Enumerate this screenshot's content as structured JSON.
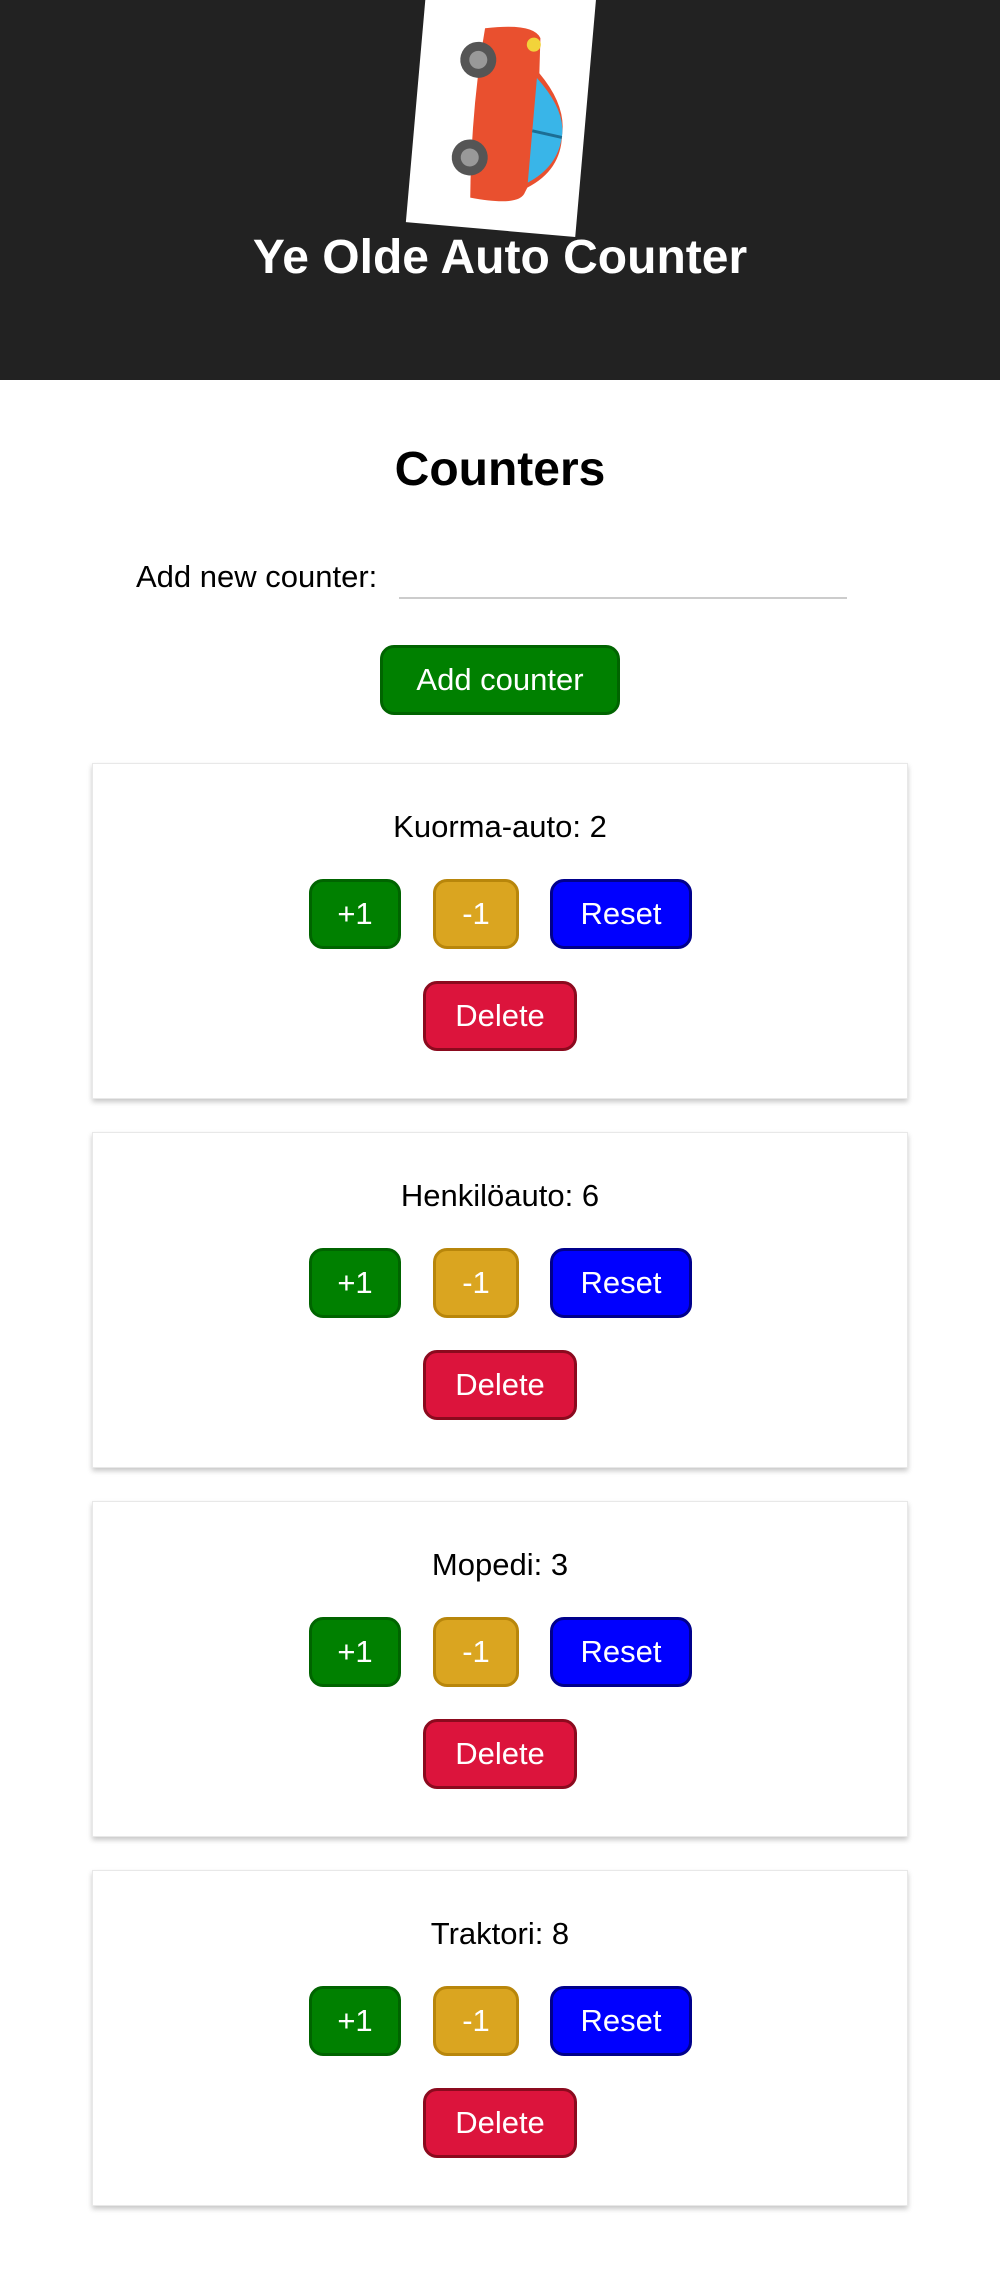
{
  "header": {
    "title": "Ye Olde Auto Counter",
    "logo_icon": "car-icon"
  },
  "counters_section": {
    "title": "Counters",
    "add_label": "Add new counter:",
    "input_value": "",
    "input_placeholder": "",
    "add_button_label": "Add counter"
  },
  "buttons": {
    "increment": "+1",
    "decrement": "-1",
    "reset": "Reset",
    "delete": "Delete"
  },
  "counters": [
    {
      "label": "Kuorma-auto: 2"
    },
    {
      "label": "Henkilöauto: 6"
    },
    {
      "label": "Mopedi: 3"
    },
    {
      "label": "Traktori: 8"
    }
  ],
  "colors": {
    "header_bg": "#222222",
    "increment": "#008000",
    "decrement": "#DAA520",
    "reset": "#0000FF",
    "delete": "#DC143C"
  }
}
